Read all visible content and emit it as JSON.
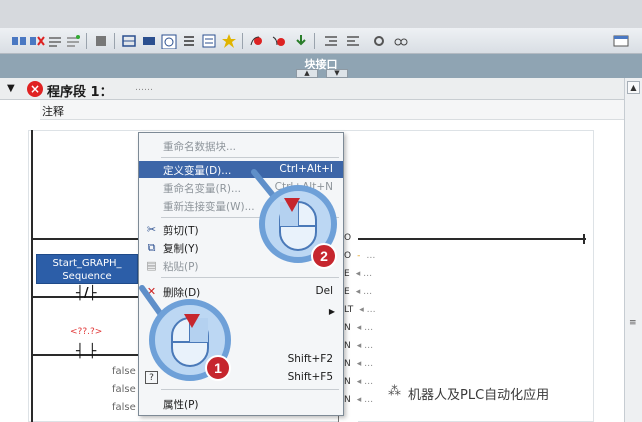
{
  "window": {
    "title": "块接口"
  },
  "network": {
    "label": "程序段 1：",
    "dots": "……",
    "comment": "注释"
  },
  "block": {
    "name_line1": "Start_GRAPH_",
    "name_line2": "Sequence"
  },
  "placeholder_tag": "<??.?>",
  "false_values": [
    "false",
    "false",
    "false"
  ],
  "context_menu": {
    "rename_block": "重命名数据块...",
    "define_variable": "定义变量(D)...",
    "define_variable_shortcut": "Ctrl+Alt+I",
    "rename_variable": "重命名变量(R)...",
    "rename_variable_shortcut": "Ctrl+Alt+N",
    "reconnect_variable": "重新连接变量(W)...",
    "cut": "剪切(T)",
    "copy": "复制(Y)",
    "paste": "粘贴(P)",
    "delete": "删除(D)",
    "delete_shortcut": "Del",
    "shortcut_f2": "Shift+F2",
    "shortcut_f5": "Shift+F5",
    "properties": "属性(P)"
  },
  "pins": [
    "O",
    "O",
    "E",
    "E",
    "LT",
    "N",
    "N",
    "N",
    "N",
    "N"
  ],
  "callouts": {
    "step1": "1",
    "step2": "2"
  },
  "watermark": "机器人及PLC自动化应用",
  "colors": {
    "highlight": "#3d66a8",
    "callout_ring": "#7fb0e6",
    "callout_badge": "#c6262e",
    "block_fill": "#2c5ea8"
  }
}
